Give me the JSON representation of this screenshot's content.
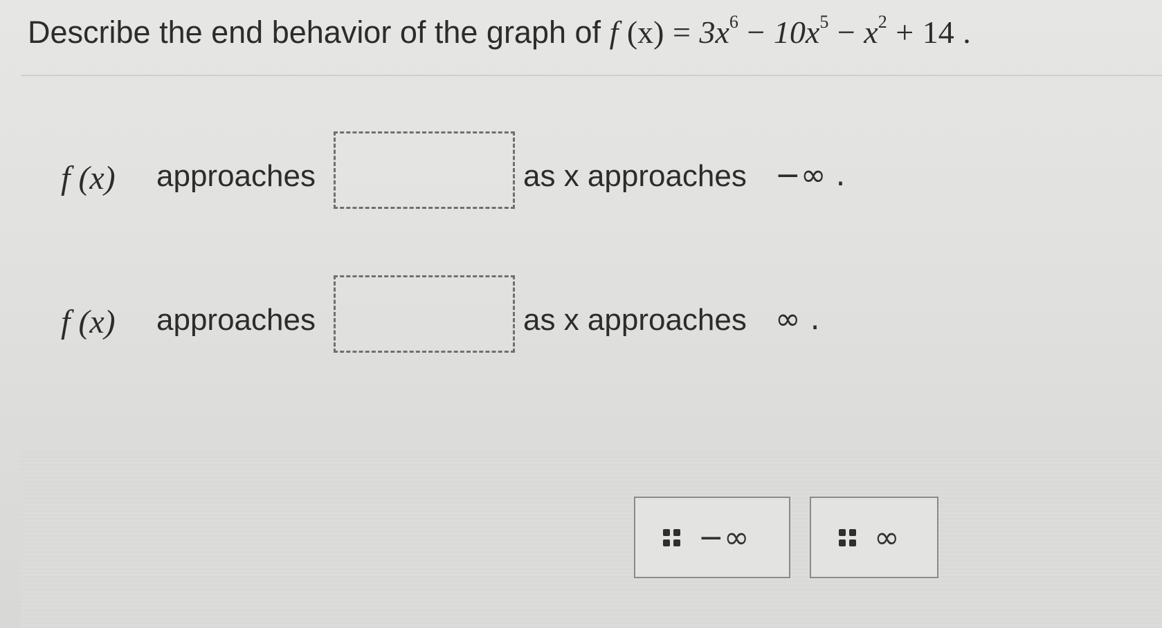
{
  "question": {
    "prefix": "Describe the end behavior of the graph of",
    "fn": "f",
    "arg": "(x)",
    "eq": "=",
    "t1_coef": "3x",
    "t1_exp": "6",
    "minus1": "−",
    "t2_coef": "10x",
    "t2_exp": "5",
    "minus2": "−",
    "t3_base": "x",
    "t3_exp": "2",
    "plus": "+",
    "const": "14",
    "end": "."
  },
  "rows": [
    {
      "fx": "f (x)",
      "approaches": "approaches",
      "as_x_approaches": "as x approaches",
      "target": "−∞ ."
    },
    {
      "fx": "f (x)",
      "approaches": "approaches",
      "as_x_approaches": "as x approaches",
      "target": "∞ ."
    }
  ],
  "options": [
    {
      "label": "−∞",
      "icon": "drag-handle-icon"
    },
    {
      "label": "∞",
      "icon": "drag-handle-icon"
    }
  ]
}
